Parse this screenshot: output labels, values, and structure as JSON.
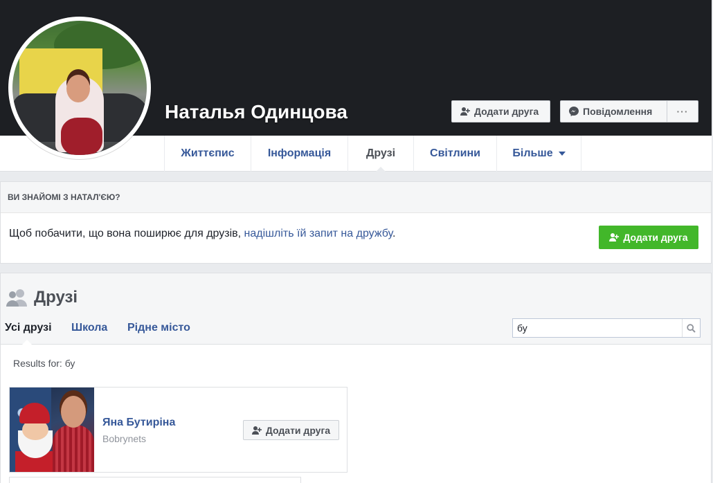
{
  "profile": {
    "name": "Наталья Одинцова",
    "add_friend_label": "Додати друга",
    "message_label": "Повідомлення",
    "more_label": "···"
  },
  "nav": {
    "tabs": [
      {
        "label": "Життєпис"
      },
      {
        "label": "Інформація"
      },
      {
        "label": "Друзі"
      },
      {
        "label": "Світлини"
      },
      {
        "label": "Більше"
      }
    ],
    "active_tab": "Друзі"
  },
  "know_panel": {
    "heading": "ВИ ЗНАЙОМІ З НАТАЛ'ЄЮ?",
    "text_before_link": "Щоб побачити, що вона поширює для друзів, ",
    "link_text": "надішліть їй запит на дружбу",
    "text_after_link": ".",
    "button_label": "Додати друга"
  },
  "friends_panel": {
    "title": "Друзі",
    "tabs": [
      {
        "label": "Усі друзі"
      },
      {
        "label": "Школа"
      },
      {
        "label": "Рідне місто"
      }
    ],
    "active_tab": "Усі друзі",
    "search_value": "бу",
    "results_for": "Results for: бу",
    "results": [
      {
        "name": "Яна Бутиріна",
        "subtitle": "Bobrynets",
        "button_label": "Додати друга"
      }
    ]
  },
  "colors": {
    "cover_bg": "#1d1f23",
    "link_blue": "#365899",
    "green_button": "#42b72a",
    "page_bg": "#e9ebee"
  },
  "icons": {
    "add_friend": "add-friend-icon",
    "messenger": "messenger-icon",
    "friends": "friends-icon",
    "search": "search-icon",
    "dropdown": "caret-down-icon"
  }
}
